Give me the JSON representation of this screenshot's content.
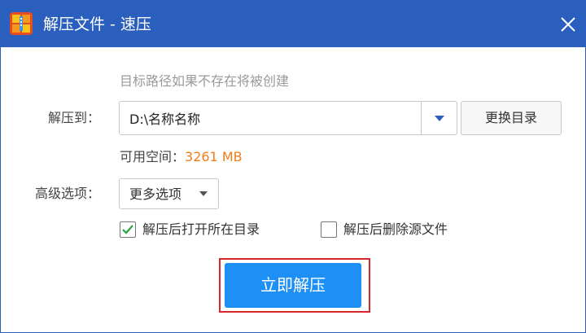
{
  "window": {
    "title": "解压文件 - 速压",
    "logo_icon": "speedzip-logo-icon",
    "close_icon": "close-icon",
    "accent_color": "#2b5fbd"
  },
  "form": {
    "hint": "目标路径如果不存在将被创建",
    "extract_to_label": "解压到：",
    "path_value": "D:\\名称名称",
    "change_dir_label": "更换目录",
    "free_space_label": "可用空间：",
    "free_space_value": "3261 MB",
    "advanced_label": "高级选项：",
    "more_options_label": "更多选项"
  },
  "options": {
    "open_folder": {
      "label": "解压后打开所在目录",
      "checked": true
    },
    "delete_source": {
      "label": "解压后删除源文件",
      "checked": false
    }
  },
  "actions": {
    "extract_now_label": "立即解压",
    "extract_color": "#1e90f5",
    "highlight_color": "#d9262b"
  }
}
